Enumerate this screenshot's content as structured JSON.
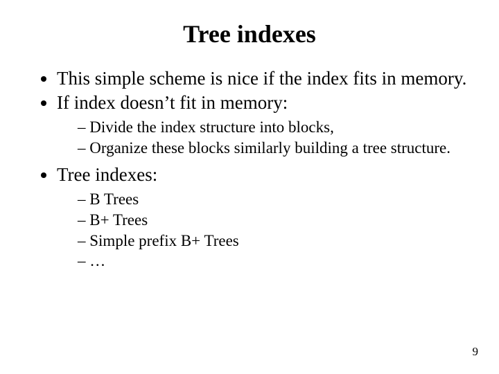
{
  "title": "Tree indexes",
  "bullets": {
    "b1": "This simple scheme is nice if the index fits in memory.",
    "b2": "If index doesn’t fit in memory:",
    "b2_sub": {
      "s1": "Divide the index structure into blocks,",
      "s2": "Organize these blocks similarly building a tree structure."
    },
    "b3": "Tree indexes:",
    "b3_sub": {
      "s1": "B Trees",
      "s2": "B+ Trees",
      "s3": "Simple prefix B+ Trees",
      "s4": "…"
    }
  },
  "page_number": "9"
}
